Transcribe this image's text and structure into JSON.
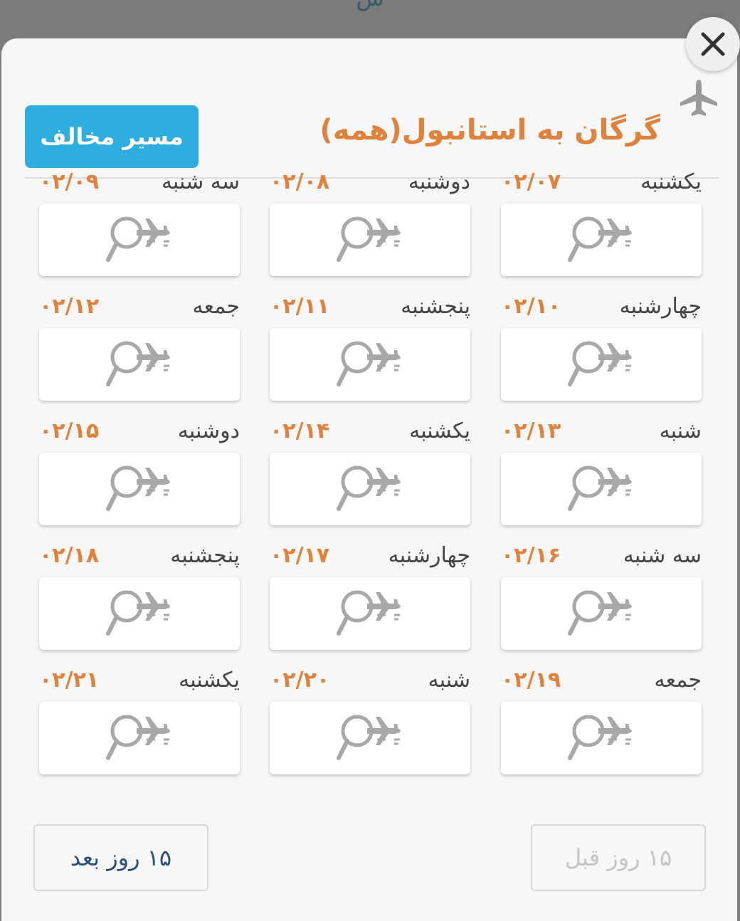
{
  "header": {
    "route_title": "گرگان به استانبول(همه)",
    "reverse_label": "مسیر مخالف",
    "top_peek": "ش"
  },
  "icons": {
    "close": "close-icon",
    "plane": "plane-icon",
    "search_flight": "search-flight-icon"
  },
  "days": [
    {
      "name": "یکشنبه",
      "date": "۰۲/۰۷"
    },
    {
      "name": "دوشنبه",
      "date": "۰۲/۰۸"
    },
    {
      "name": "سه شنبه",
      "date": "۰۲/۰۹"
    },
    {
      "name": "چهارشنبه",
      "date": "۰۲/۱۰"
    },
    {
      "name": "پنجشنبه",
      "date": "۰۲/۱۱"
    },
    {
      "name": "جمعه",
      "date": "۰۲/۱۲"
    },
    {
      "name": "شنبه",
      "date": "۰۲/۱۳"
    },
    {
      "name": "یکشنبه",
      "date": "۰۲/۱۴"
    },
    {
      "name": "دوشنبه",
      "date": "۰۲/۱۵"
    },
    {
      "name": "سه شنبه",
      "date": "۰۲/۱۶"
    },
    {
      "name": "چهارشنبه",
      "date": "۰۲/۱۷"
    },
    {
      "name": "پنجشنبه",
      "date": "۰۲/۱۸"
    },
    {
      "name": "جمعه",
      "date": "۰۲/۱۹"
    },
    {
      "name": "شنبه",
      "date": "۰۲/۲۰"
    },
    {
      "name": "یکشنبه",
      "date": "۰۲/۲۱"
    }
  ],
  "footer": {
    "prev_label": "۱۵ روز قبل",
    "next_label": "۱۵ روز بعد"
  },
  "colors": {
    "accent_orange": "#e0823c",
    "button_blue": "#2eaee0",
    "next_text": "#2b4f7a",
    "disabled_text": "#c4c4c4"
  }
}
